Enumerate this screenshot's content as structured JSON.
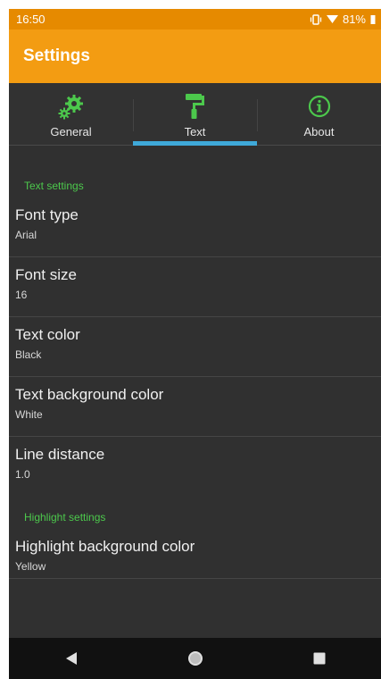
{
  "status_bar": {
    "time": "16:50",
    "battery": "81%"
  },
  "app_bar": {
    "title": "Settings"
  },
  "tabs": [
    {
      "label": "General",
      "icon": "gears-icon",
      "active": false
    },
    {
      "label": "Text",
      "icon": "paint-roller-icon",
      "active": true
    },
    {
      "label": "About",
      "icon": "info-icon",
      "active": false
    }
  ],
  "sections": [
    {
      "header": "Text settings",
      "items": [
        {
          "title": "Font type",
          "summary": "Arial"
        },
        {
          "title": "Font size",
          "summary": "16"
        },
        {
          "title": "Text color",
          "summary": "Black"
        },
        {
          "title": "Text background color",
          "summary": "White"
        },
        {
          "title": "Line distance",
          "summary": "1.0"
        }
      ]
    },
    {
      "header": "Highlight settings",
      "items": [
        {
          "title": "Highlight background color",
          "summary": "Yellow"
        }
      ]
    }
  ],
  "colors": {
    "appbar": "#f39c12",
    "statusbar": "#e68a00",
    "accent_green": "#4cc84c",
    "tab_indicator": "#3fa9d9",
    "background": "#303030"
  },
  "nav_bar": {
    "buttons": [
      "back-icon",
      "home-icon",
      "recents-icon"
    ]
  }
}
